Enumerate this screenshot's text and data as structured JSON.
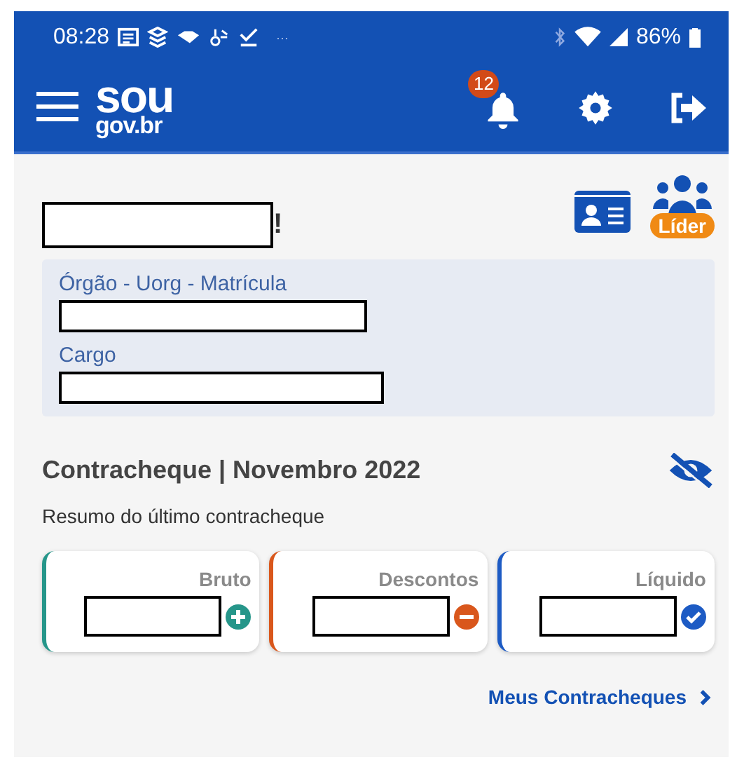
{
  "status_bar": {
    "time": "08:28",
    "more": "···",
    "battery": "86%"
  },
  "app_bar": {
    "logo_top": "sou",
    "logo_bottom": "gov.br",
    "notifications": "12"
  },
  "profile": {
    "name_suffix": "!",
    "badge": "Líder",
    "fields": [
      {
        "label": "Órgão - Uorg - Matrícula"
      },
      {
        "label": "Cargo"
      }
    ]
  },
  "payslip": {
    "title": "Contracheque | Novembro 2022",
    "subtitle": "Resumo do último contracheque",
    "cards": [
      {
        "label": "Bruto",
        "kind": "plus",
        "color": "#26968a"
      },
      {
        "label": "Descontos",
        "kind": "minus",
        "color": "#d9571c"
      },
      {
        "label": "Líquido",
        "kind": "check",
        "color": "#1d5bc4"
      }
    ],
    "link": "Meus Contracheques"
  }
}
